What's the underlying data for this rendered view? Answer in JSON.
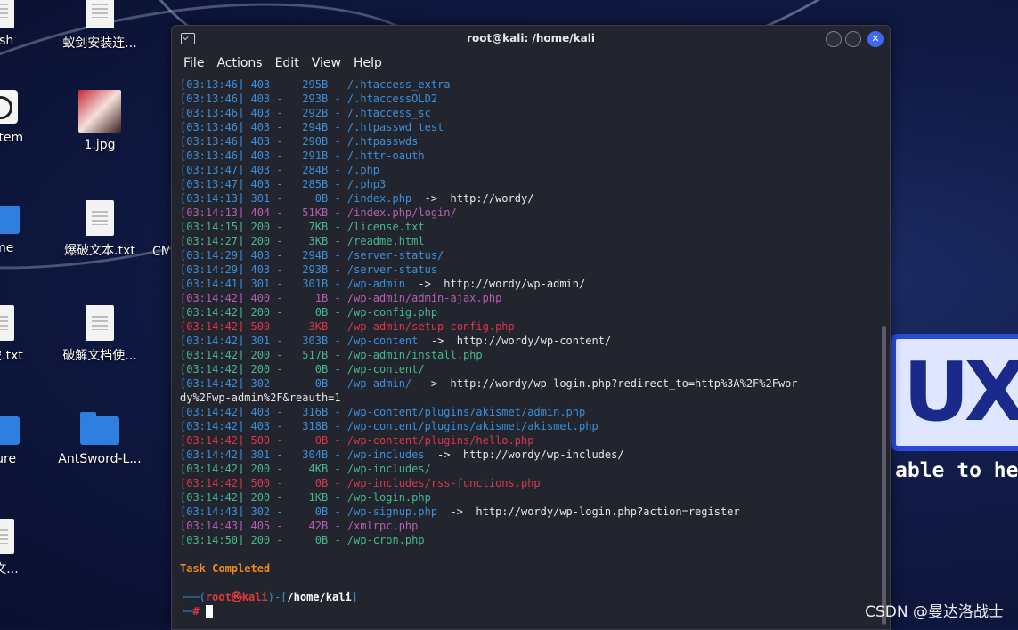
{
  "desktop": {
    "watermark": "CSDN @曼达洛战士",
    "tagline": "able to he",
    "logo_text": "UX",
    "icons": [
      {
        "label": "rash",
        "type": "doc"
      },
      {
        "label": "蚁剑安装连...",
        "type": "doc"
      },
      {
        "label": "System",
        "type": "disk"
      },
      {
        "label": "1.jpg",
        "type": "image"
      },
      {
        "label": "ome",
        "type": "folder"
      },
      {
        "label": "爆破文本.txt",
        "type": "doc"
      },
      {
        "label": "CM",
        "type": "doc"
      },
      {
        "label": "爆破.txt",
        "type": "doc"
      },
      {
        "label": "破解文档使...",
        "type": "doc"
      },
      {
        "label": "cture",
        "type": "folder"
      },
      {
        "label": "AntSword-L...",
        "type": "folder"
      },
      {
        "label": "本文...",
        "type": "doc"
      }
    ]
  },
  "window": {
    "title": "root@kali: /home/kali",
    "menu": [
      "File",
      "Actions",
      "Edit",
      "View",
      "Help"
    ]
  },
  "terminal": {
    "lines": [
      {
        "time": "[03:13:46]",
        "code": "403",
        "size": "  295B",
        "path": "/.htaccess_extra",
        "redirect": ""
      },
      {
        "time": "[03:13:46]",
        "code": "403",
        "size": "  293B",
        "path": "/.htaccessOLD2",
        "redirect": ""
      },
      {
        "time": "[03:13:46]",
        "code": "403",
        "size": "  292B",
        "path": "/.htaccess_sc",
        "redirect": ""
      },
      {
        "time": "[03:13:46]",
        "code": "403",
        "size": "  294B",
        "path": "/.htpasswd_test",
        "redirect": ""
      },
      {
        "time": "[03:13:46]",
        "code": "403",
        "size": "  290B",
        "path": "/.htpasswds",
        "redirect": ""
      },
      {
        "time": "[03:13:46]",
        "code": "403",
        "size": "  291B",
        "path": "/.httr-oauth",
        "redirect": ""
      },
      {
        "time": "[03:13:47]",
        "code": "403",
        "size": "  284B",
        "path": "/.php",
        "redirect": ""
      },
      {
        "time": "[03:13:47]",
        "code": "403",
        "size": "  285B",
        "path": "/.php3",
        "redirect": ""
      },
      {
        "time": "[03:14:13]",
        "code": "301",
        "size": "    0B",
        "path": "/index.php",
        "redirect": "  ->  http://wordy/"
      },
      {
        "time": "[03:14:13]",
        "code": "404",
        "size": "  51KB",
        "path": "/index.php/login/",
        "redirect": ""
      },
      {
        "time": "[03:14:15]",
        "code": "200",
        "size": "   7KB",
        "path": "/license.txt",
        "redirect": ""
      },
      {
        "time": "[03:14:27]",
        "code": "200",
        "size": "   3KB",
        "path": "/readme.html",
        "redirect": ""
      },
      {
        "time": "[03:14:29]",
        "code": "403",
        "size": "  294B",
        "path": "/server-status/",
        "redirect": ""
      },
      {
        "time": "[03:14:29]",
        "code": "403",
        "size": "  293B",
        "path": "/server-status",
        "redirect": ""
      },
      {
        "time": "[03:14:41]",
        "code": "301",
        "size": "  301B",
        "path": "/wp-admin",
        "redirect": "  ->  http://wordy/wp-admin/"
      },
      {
        "time": "[03:14:42]",
        "code": "400",
        "size": "    1B",
        "path": "/wp-admin/admin-ajax.php",
        "redirect": ""
      },
      {
        "time": "[03:14:42]",
        "code": "200",
        "size": "    0B",
        "path": "/wp-config.php",
        "redirect": ""
      },
      {
        "time": "[03:14:42]",
        "code": "500",
        "size": "   3KB",
        "path": "/wp-admin/setup-config.php",
        "redirect": ""
      },
      {
        "time": "[03:14:42]",
        "code": "301",
        "size": "  303B",
        "path": "/wp-content",
        "redirect": "  ->  http://wordy/wp-content/"
      },
      {
        "time": "[03:14:42]",
        "code": "200",
        "size": "  517B",
        "path": "/wp-admin/install.php",
        "redirect": ""
      },
      {
        "time": "[03:14:42]",
        "code": "200",
        "size": "    0B",
        "path": "/wp-content/",
        "redirect": ""
      },
      {
        "time": "[03:14:42]",
        "code": "302",
        "size": "    0B",
        "path": "/wp-admin/",
        "redirect": "  ->  http://wordy/wp-login.php?redirect_to=http%3A%2F%2Fwor"
      },
      {
        "time": "",
        "code": "",
        "size": "",
        "path": "",
        "redirect": "dy%2Fwp-admin%2F&reauth=1"
      },
      {
        "time": "[03:14:42]",
        "code": "403",
        "size": "  316B",
        "path": "/wp-content/plugins/akismet/admin.php",
        "redirect": ""
      },
      {
        "time": "[03:14:42]",
        "code": "403",
        "size": "  318B",
        "path": "/wp-content/plugins/akismet/akismet.php",
        "redirect": ""
      },
      {
        "time": "[03:14:42]",
        "code": "500",
        "size": "    0B",
        "path": "/wp-content/plugins/hello.php",
        "redirect": ""
      },
      {
        "time": "[03:14:42]",
        "code": "301",
        "size": "  304B",
        "path": "/wp-includes",
        "redirect": "  ->  http://wordy/wp-includes/"
      },
      {
        "time": "[03:14:42]",
        "code": "200",
        "size": "   4KB",
        "path": "/wp-includes/",
        "redirect": ""
      },
      {
        "time": "[03:14:42]",
        "code": "500",
        "size": "    0B",
        "path": "/wp-includes/rss-functions.php",
        "redirect": ""
      },
      {
        "time": "[03:14:42]",
        "code": "200",
        "size": "   1KB",
        "path": "/wp-login.php",
        "redirect": ""
      },
      {
        "time": "[03:14:43]",
        "code": "302",
        "size": "    0B",
        "path": "/wp-signup.php",
        "redirect": "  ->  http://wordy/wp-login.php?action=register"
      },
      {
        "time": "[03:14:43]",
        "code": "405",
        "size": "   42B",
        "path": "/xmlrpc.php",
        "redirect": ""
      },
      {
        "time": "[03:14:50]",
        "code": "200",
        "size": "    0B",
        "path": "/wp-cron.php",
        "redirect": ""
      }
    ],
    "task_completed": "Task Completed",
    "prompt": {
      "open": "┌──(",
      "user": "root㉿kali",
      "mid": ")-[",
      "path": "/home/kali",
      "close": "]",
      "second": "└─",
      "hash": "# "
    }
  }
}
